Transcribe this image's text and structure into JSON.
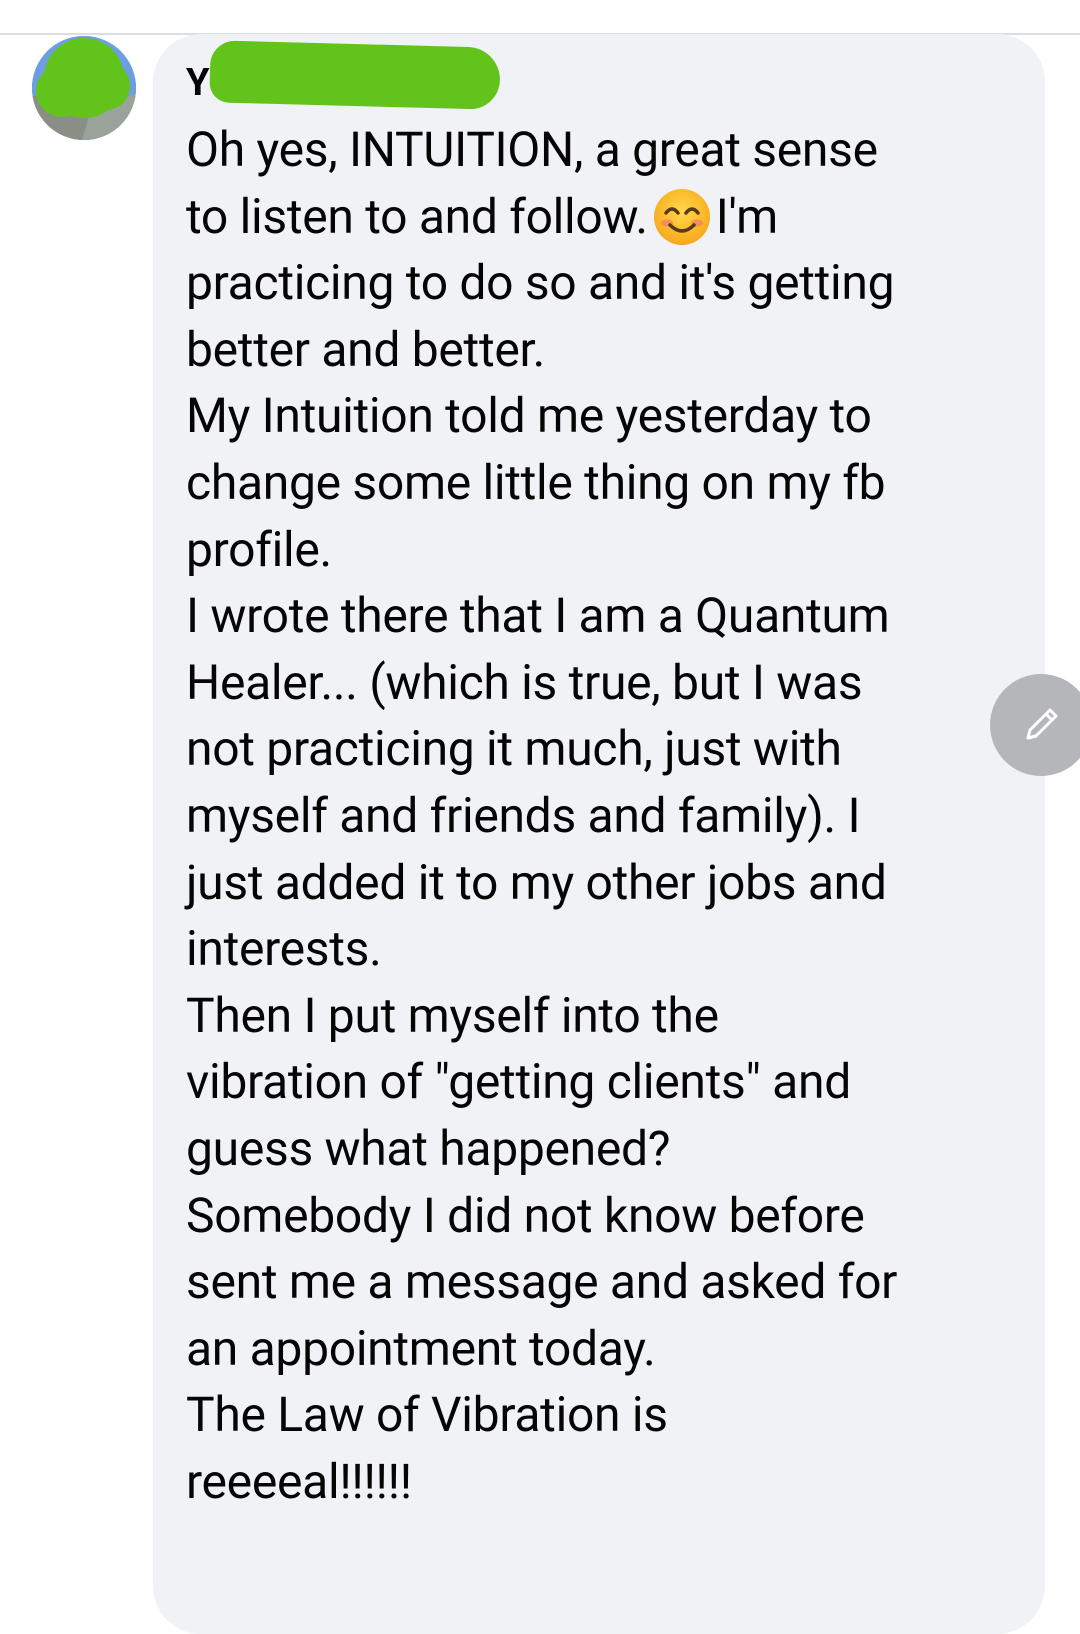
{
  "comment": {
    "author_visible": "Y",
    "lines": [
      "Oh yes, INTUITION, a great sense",
      "to listen to and follow.",
      "I'm",
      "practicing to do so and it's getting",
      "better and better.",
      "My Intuition told me yesterday to",
      "change some little thing on my fb",
      "profile.",
      "I wrote there that I am a Quantum",
      "Healer... (which is true, but I was",
      "not practicing it much, just with",
      "myself and friends and family). I",
      "just added it to my other jobs and",
      "interests.",
      "Then I put myself into the",
      "vibration of \"getting clients\" and",
      "guess what happened?",
      "Somebody I did not know before",
      "sent me a message and asked for",
      "an appointment today.",
      "The Law of Vibration is",
      "reeeeal!!!!!!"
    ],
    "emoji": "smiling-face-with-smiling-eyes-icon"
  },
  "colors": {
    "bubble": "#f0f2f5",
    "redaction": "#62c31a",
    "text": "#050505",
    "fab": "#b4b6ba"
  },
  "edit_button": {
    "icon": "pencil-icon"
  }
}
